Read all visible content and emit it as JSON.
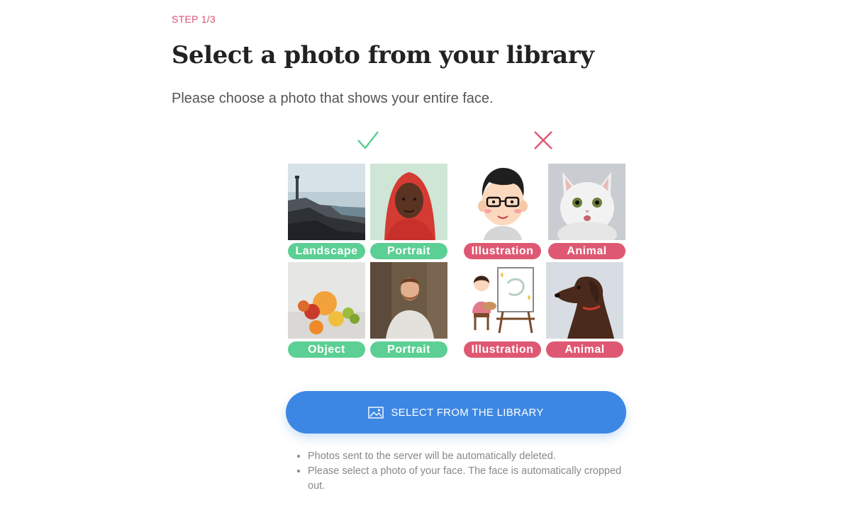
{
  "step_label": "STEP 1/3",
  "title": "Select a photo from your library",
  "subtitle": "Please choose a photo that shows your entire face.",
  "good_mark_icon": "checkmark-icon",
  "bad_mark_icon": "cross-icon",
  "colors": {
    "accent_red": "#df5873",
    "accent_green": "#5ccf94",
    "button_blue": "#3d87e4"
  },
  "examples": {
    "good": [
      {
        "label": "Landscape"
      },
      {
        "label": "Portrait"
      },
      {
        "label": "Object"
      },
      {
        "label": "Portrait"
      }
    ],
    "bad": [
      {
        "label": "Illustration"
      },
      {
        "label": "Animal"
      },
      {
        "label": "Illustration"
      },
      {
        "label": "Animal"
      }
    ]
  },
  "button": {
    "label": "SELECT FROM THE LIBRARY",
    "icon": "image-icon"
  },
  "notes": [
    "Photos sent to the server will be automatically deleted.",
    "Please select a photo of your face. The face is automatically cropped out."
  ]
}
